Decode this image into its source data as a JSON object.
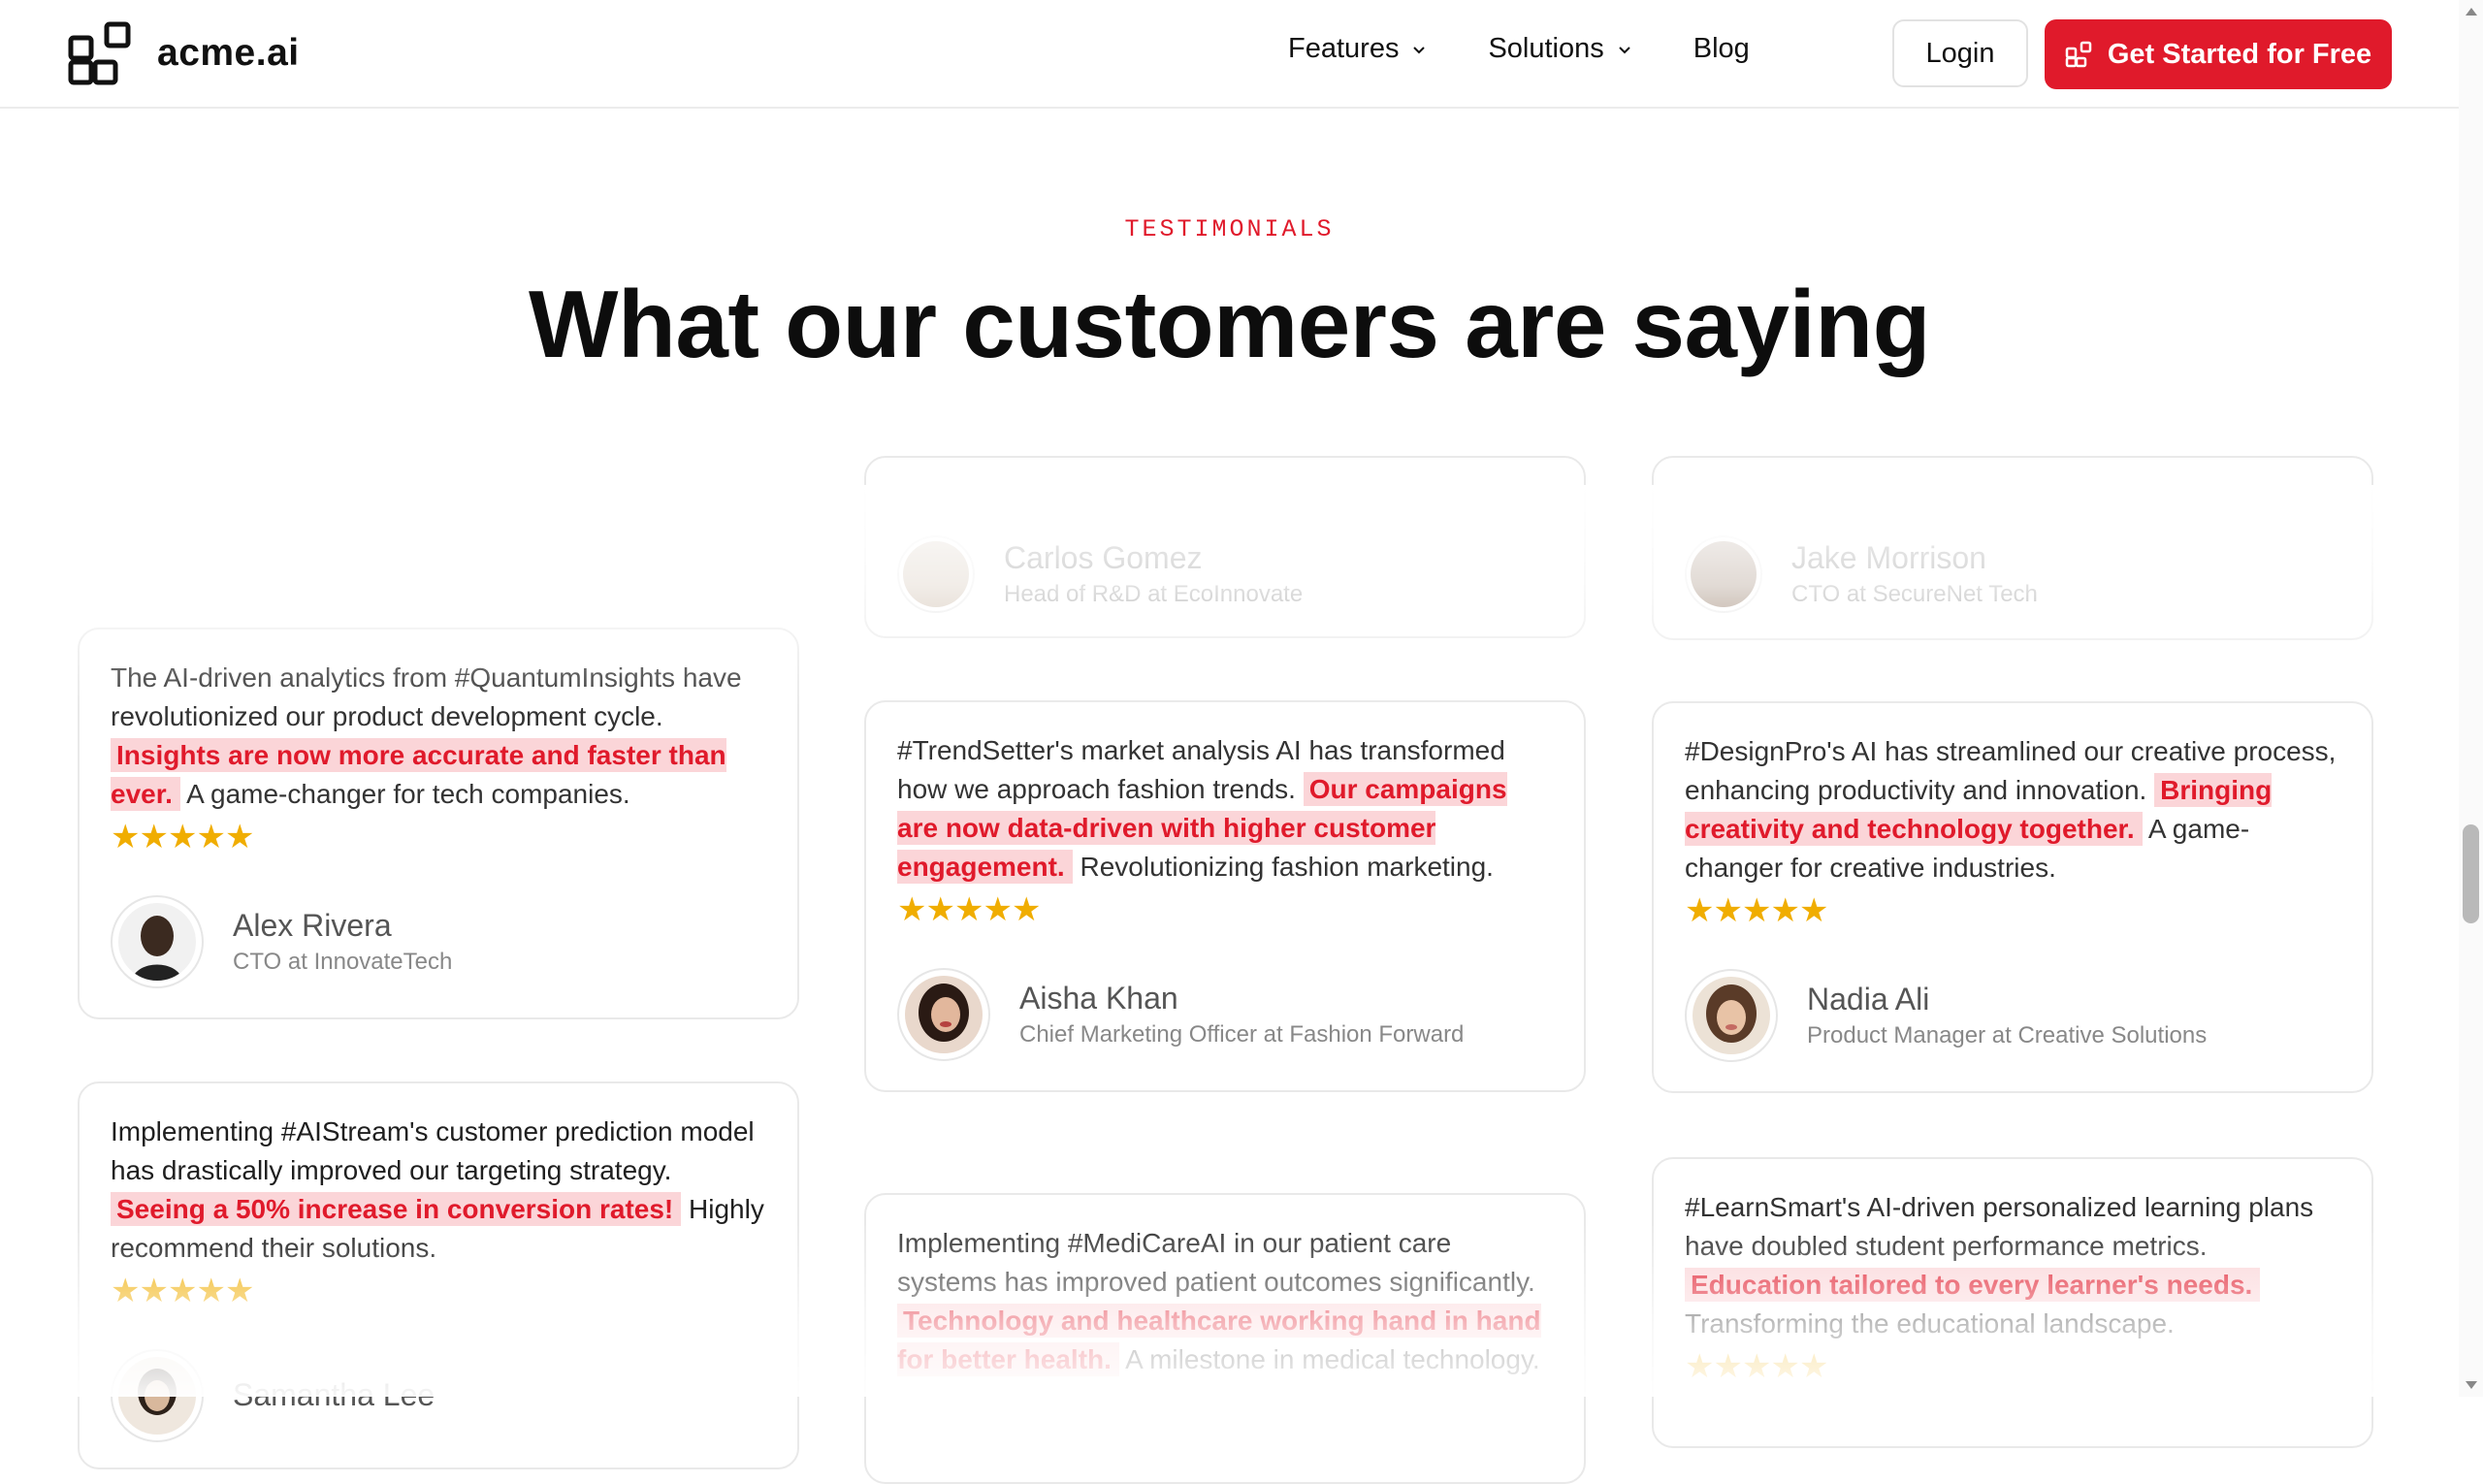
{
  "brand": {
    "name": "acme.ai",
    "accent": "#e01a2b"
  },
  "nav": {
    "items": [
      {
        "label": "Features",
        "has_dropdown": true
      },
      {
        "label": "Solutions",
        "has_dropdown": true
      },
      {
        "label": "Blog",
        "has_dropdown": false
      }
    ],
    "login_label": "Login",
    "cta_label": "Get Started for Free"
  },
  "section": {
    "eyebrow": "TESTIMONIALS",
    "title": "What our customers are saying"
  },
  "partial_cards": [
    {
      "name": "Carlos Gomez",
      "role": "Head of R&D at EcoInnovate"
    },
    {
      "name": "Jake Morrison",
      "role": "CTO at SecureNet Tech"
    }
  ],
  "testimonials": [
    {
      "before": "The AI-driven analytics from #QuantumInsights have revolutionized our product development cycle. ",
      "highlight": "Insights are now more accurate and faster than ever.",
      "after": " A game-changer for tech companies.",
      "rating": 5,
      "name": "Alex Rivera",
      "role": "CTO at InnovateTech"
    },
    {
      "before": "Implementing #AIStream's customer prediction model has drastically improved our targeting strategy. ",
      "highlight": "Seeing a 50% increase in conversion rates!",
      "after": " Highly recommend their solutions.",
      "rating": 5,
      "name": "Samantha Lee",
      "role": ""
    },
    {
      "before": "#TrendSetter's market analysis AI has transformed how we approach fashion trends. ",
      "highlight": "Our campaigns are now data-driven with higher customer engagement.",
      "after": " Revolutionizing fashion marketing.",
      "rating": 5,
      "name": "Aisha Khan",
      "role": "Chief Marketing Officer at Fashion Forward"
    },
    {
      "before": "Implementing #MediCareAI in our patient care systems has improved patient outcomes significantly. ",
      "highlight": "Technology and healthcare working hand in hand for better health.",
      "after": " A milestone in medical technology.",
      "rating": 5,
      "name": "",
      "role": ""
    },
    {
      "before": "#DesignPro's AI has streamlined our creative process, enhancing productivity and innovation. ",
      "highlight": "Bringing creativity and technology together.",
      "after": " A game-changer for creative industries.",
      "rating": 5,
      "name": "Nadia Ali",
      "role": "Product Manager at Creative Solutions"
    },
    {
      "before": "#LearnSmart's AI-driven personalized learning plans have doubled student performance metrics. ",
      "highlight": "Education tailored to every learner's needs.",
      "after": " Transforming the educational landscape.",
      "rating": 5,
      "name": "",
      "role": ""
    }
  ],
  "icons": {
    "logo": "acme-logo-icon",
    "chevron": "chevron-down-icon",
    "cta": "grid-plus-icon",
    "star": "star-icon"
  }
}
